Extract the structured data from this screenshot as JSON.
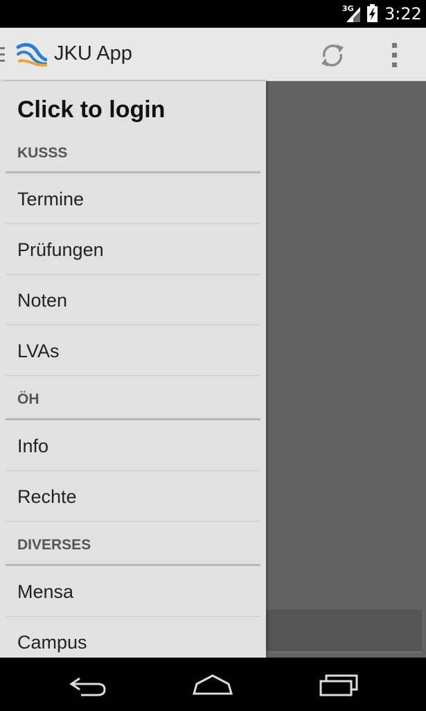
{
  "status_bar": {
    "network": "3G",
    "time": "3:22"
  },
  "action_bar": {
    "title": "JKU App",
    "icons": {
      "logo": "jku-logo-icon",
      "refresh": "refresh-icon",
      "overflow": "overflow-menu-icon"
    }
  },
  "drawer": {
    "header": "Click to login",
    "sections": [
      {
        "title": "KUSSS",
        "items": [
          "Termine",
          "Prüfungen",
          "Noten",
          "LVAs"
        ]
      },
      {
        "title": "ÖH",
        "items": [
          "Info",
          "Rechte"
        ]
      },
      {
        "title": "DIVERSES",
        "items": [
          "Mensa",
          "Campus"
        ]
      }
    ]
  },
  "nav_bar": {
    "icons": [
      "back-icon",
      "home-icon",
      "recent-apps-icon"
    ]
  },
  "colors": {
    "drawer_bg": "#e1e1e1",
    "action_bar_bg": "#e8e8e8",
    "dim_overlay": "#636363",
    "logo_blue": "#2a7fd4",
    "logo_orange": "#f0a23a"
  }
}
